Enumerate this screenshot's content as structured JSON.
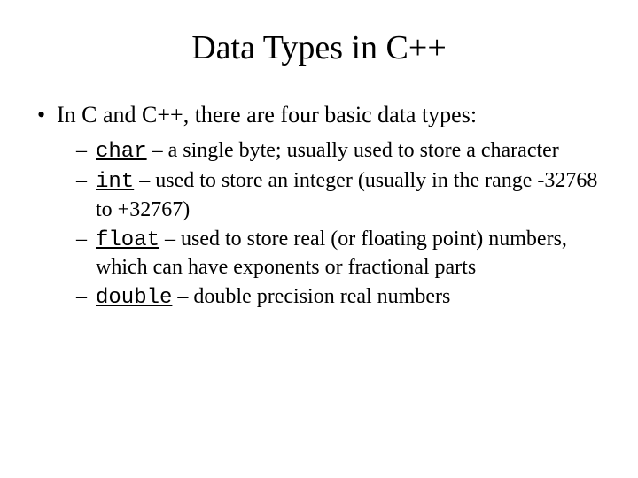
{
  "title": "Data Types in C++",
  "main_bullet": "In C and C++, there are four basic data types:",
  "items": [
    {
      "kw": "char",
      "desc": " – a single byte; usually used to store a character"
    },
    {
      "kw": "int",
      "desc": " – used to store an integer (usually in the  range -32768 to +32767)"
    },
    {
      "kw": "float",
      "desc": " – used to store real (or floating point) numbers, which can have exponents or fractional parts"
    },
    {
      "kw": "double",
      "desc": " – double precision real numbers"
    }
  ]
}
